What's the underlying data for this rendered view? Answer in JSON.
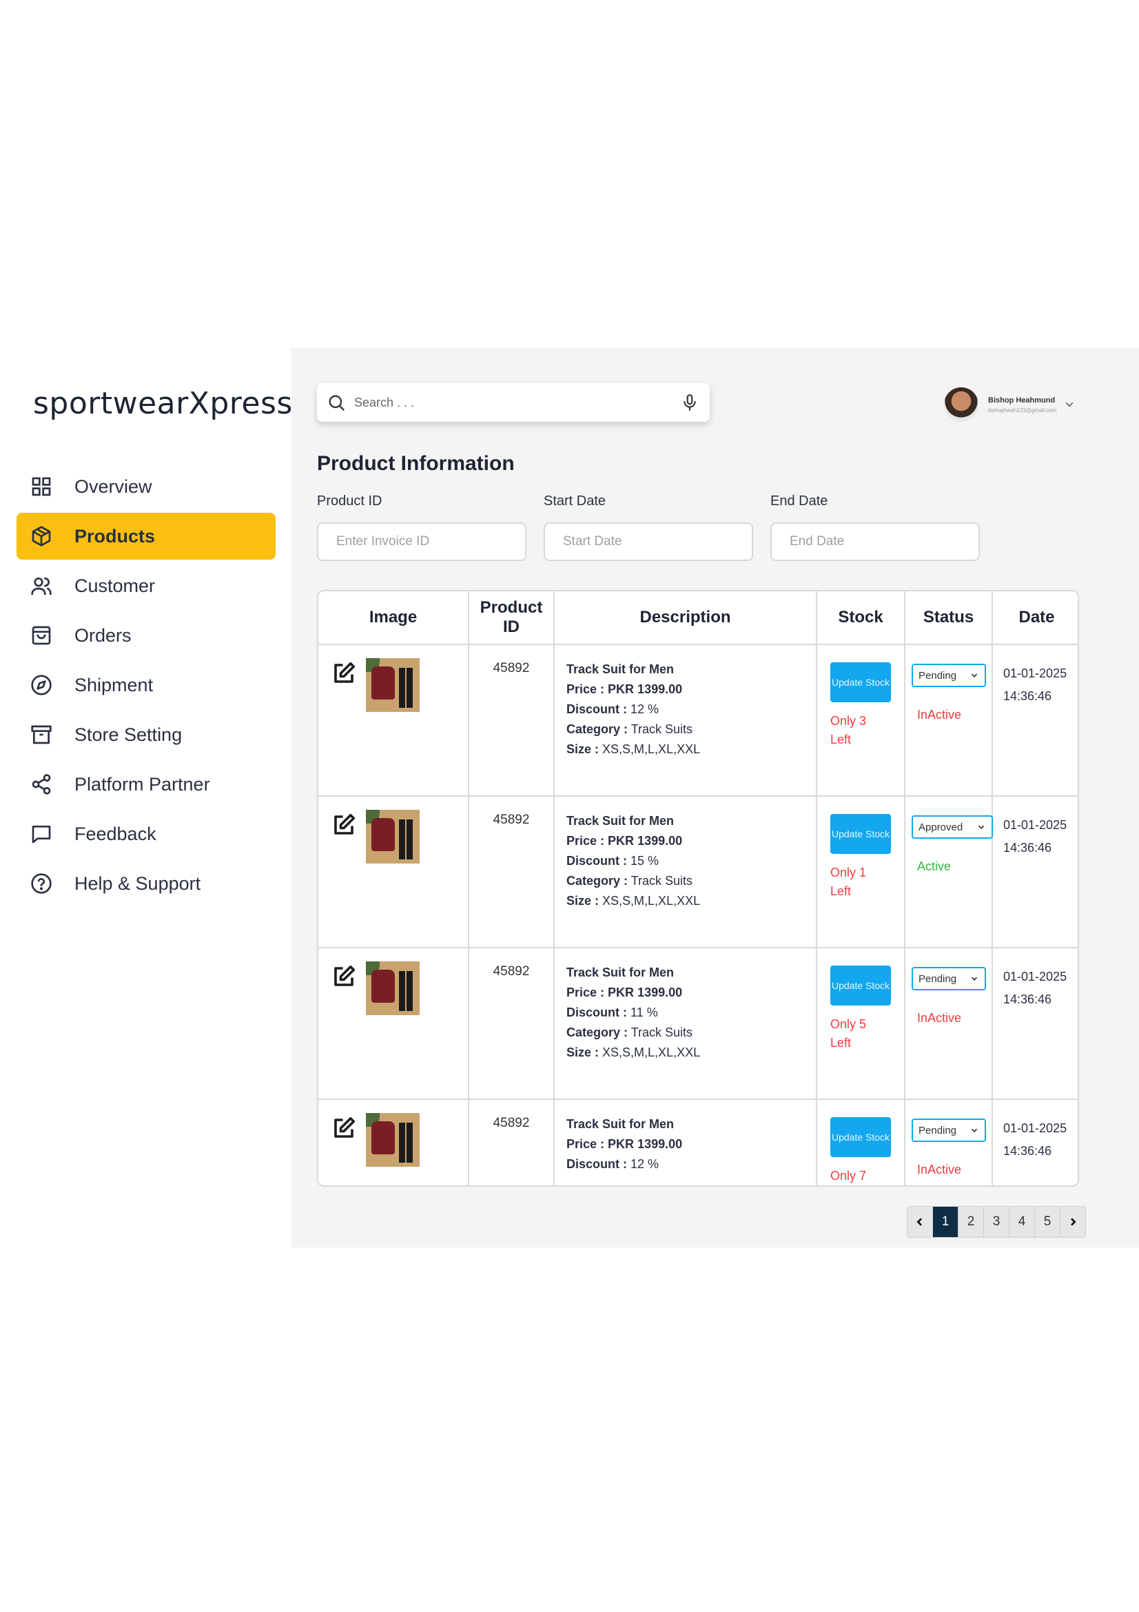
{
  "brand": "sportwearXpress",
  "sidebar": {
    "items": [
      {
        "label": "Overview",
        "icon": "grid-icon",
        "active": false
      },
      {
        "label": "Products",
        "icon": "box-icon",
        "active": true
      },
      {
        "label": "Customer",
        "icon": "users-icon",
        "active": false
      },
      {
        "label": "Orders",
        "icon": "bag-icon",
        "active": false
      },
      {
        "label": "Shipment",
        "icon": "compass-icon",
        "active": false
      },
      {
        "label": "Store Setting",
        "icon": "archive-icon",
        "active": false
      },
      {
        "label": "Platform Partner",
        "icon": "share-icon",
        "active": false
      },
      {
        "label": "Feedback",
        "icon": "message-icon",
        "active": false
      },
      {
        "label": "Help & Support",
        "icon": "help-icon",
        "active": false
      }
    ]
  },
  "search": {
    "placeholder": "Search . . ."
  },
  "user": {
    "name": "Bishop Heahmund",
    "email": "bishopheah123@gmail.com"
  },
  "page_title": "Product Information",
  "filters": {
    "product_id": {
      "label": "Product ID",
      "placeholder": "Enter Invoice ID"
    },
    "start_date": {
      "label": "Start Date",
      "placeholder": "Start Date"
    },
    "end_date": {
      "label": "End Date",
      "placeholder": "End Date"
    }
  },
  "table": {
    "headers": [
      "Image",
      "Product ID",
      "Description",
      "Stock",
      "Status",
      "Date"
    ],
    "labels": {
      "price": "Price :",
      "discount": "Discount :",
      "category": "Category :",
      "size": "Size :",
      "update_stock": "Update Stock"
    },
    "rows": [
      {
        "id": "45892",
        "title": "Track Suit for Men",
        "price": "PKR 1399.00",
        "discount": "12 %",
        "category": "Track Suits",
        "size": "XS,S,M,L,XL,XXL",
        "stock_note": "Only 3 Left",
        "select": "Pending",
        "status": "InActive",
        "date": "01-01-2025",
        "time": "14:36:46"
      },
      {
        "id": "45892",
        "title": "Track Suit for Men",
        "price": "PKR 1399.00",
        "discount": "15 %",
        "category": "Track Suits",
        "size": "XS,S,M,L,XL,XXL",
        "stock_note": "Only 1 Left",
        "select": "Approved",
        "status": "Active",
        "date": "01-01-2025",
        "time": "14:36:46"
      },
      {
        "id": "45892",
        "title": "Track Suit for Men",
        "price": "PKR 1399.00",
        "discount": "11 %",
        "category": "Track Suits",
        "size": "XS,S,M,L,XL,XXL",
        "stock_note": "Only 5 Left",
        "select": "Pending",
        "status": "InActive",
        "date": "01-01-2025",
        "time": "14:36:46"
      },
      {
        "id": "45892",
        "title": "Track Suit for Men",
        "price": "PKR 1399.00",
        "discount": "12 %",
        "stock_note": "Only 7",
        "select": "Pending",
        "status": "InActive",
        "date": "01-01-2025",
        "time": "14:36:46"
      }
    ]
  },
  "pagination": {
    "pages": [
      "1",
      "2",
      "3",
      "4",
      "5"
    ],
    "current": "1"
  },
  "colors": {
    "accent": "#fbbf0f",
    "primary_button": "#12a7ef",
    "inactive": "#ef3b3b",
    "active": "#2fbd3c",
    "pager_current": "#0f2d44"
  }
}
